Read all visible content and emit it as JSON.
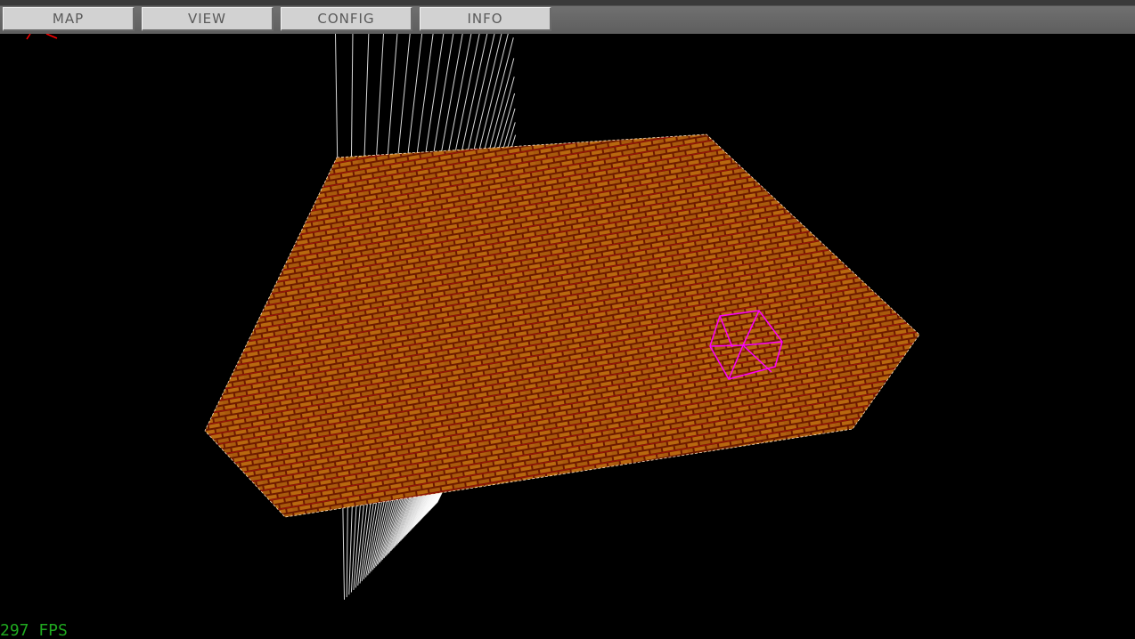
{
  "menu": {
    "items": [
      {
        "label": "MAP"
      },
      {
        "label": "VIEW"
      },
      {
        "label": "CONFIG"
      },
      {
        "label": "INFO"
      }
    ]
  },
  "status": {
    "fps_text": "297 FPS"
  },
  "scene": {
    "grid_color": "#ffffff",
    "block_color": "#7a1c00",
    "brick_color": "#c0700e",
    "mortar_color": "#b01010",
    "cursor_cube_color": "#ff00ff",
    "axis_color": "#ff0000"
  }
}
